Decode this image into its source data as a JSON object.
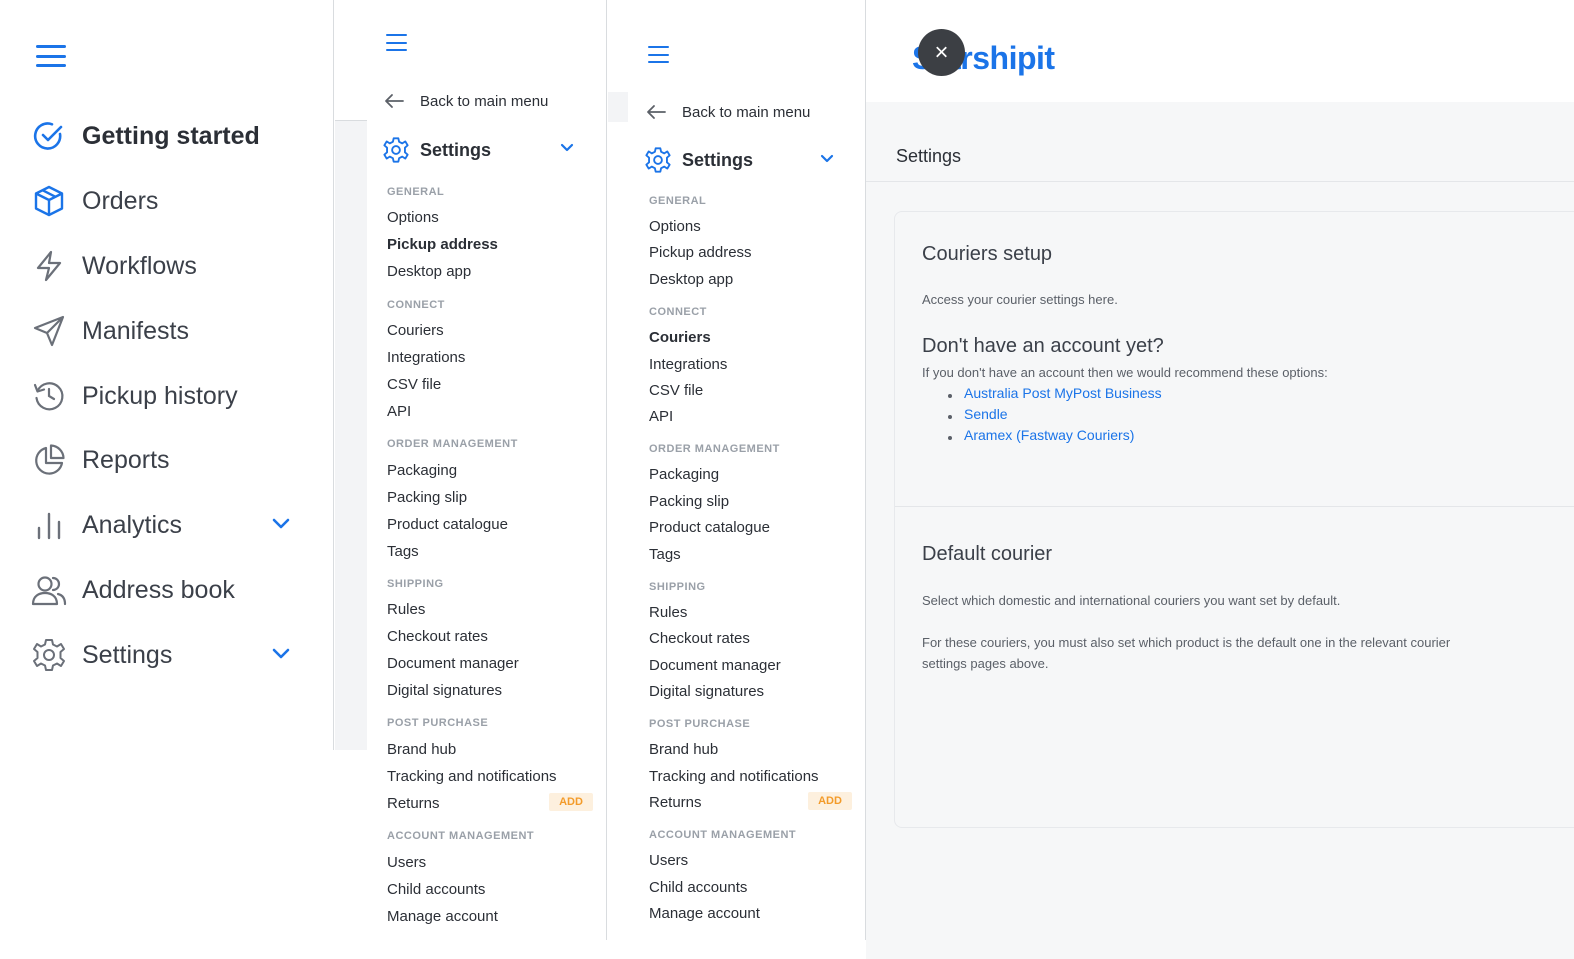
{
  "main_menu": {
    "items": [
      {
        "label": "Getting started"
      },
      {
        "label": "Orders"
      },
      {
        "label": "Workflows"
      },
      {
        "label": "Manifests"
      },
      {
        "label": "Pickup history"
      },
      {
        "label": "Reports"
      },
      {
        "label": "Analytics"
      },
      {
        "label": "Address book"
      },
      {
        "label": "Settings"
      }
    ]
  },
  "submenu": {
    "back_label": "Back to main menu",
    "settings_label": "Settings",
    "sections": {
      "general": "GENERAL",
      "connect": "CONNECT",
      "order_management": "ORDER MANAGEMENT",
      "shipping": "SHIPPING",
      "post_purchase": "POST PURCHASE",
      "account_management": "ACCOUNT MANAGEMENT"
    },
    "links": {
      "options": "Options",
      "pickup_address": "Pickup address",
      "desktop_app": "Desktop app",
      "couriers": "Couriers",
      "integrations": "Integrations",
      "csv_file": "CSV file",
      "api": "API",
      "packaging": "Packaging",
      "packing_slip": "Packing slip",
      "product_catalogue": "Product catalogue",
      "tags": "Tags",
      "rules": "Rules",
      "checkout_rates": "Checkout rates",
      "document_manager": "Document manager",
      "digital_signatures": "Digital signatures",
      "brand_hub": "Brand hub",
      "tracking": "Tracking and notifications",
      "returns": "Returns",
      "users": "Users",
      "child_accounts": "Child accounts",
      "manage_account": "Manage account"
    },
    "add_badge": "ADD"
  },
  "content": {
    "logo": "Starshipit",
    "close_symbol": "×",
    "page_title": "Settings",
    "couriers_setup": {
      "title": "Couriers setup",
      "desc": "Access your courier settings here.",
      "no_account_title": "Don't have an account yet?",
      "no_account_desc": "If you don't have an account then we would recommend these options:",
      "options": [
        "Australia Post MyPost Business",
        "Sendle",
        "Aramex (Fastway Couriers)"
      ]
    },
    "default_courier": {
      "title": "Default courier",
      "desc": "Select which domestic and international couriers you want set by default.",
      "note_line1": "For these couriers, you must also set which product is the default one in the relevant courier",
      "note_line2": "settings pages above."
    }
  },
  "colors": {
    "accent": "#1b74e8",
    "add_badge_bg": "#fdf0de",
    "add_badge_text": "#f39b2a",
    "content_bg": "#f6f7f8"
  },
  "icons": {
    "getting_started": "check-circle-icon",
    "orders": "box-icon",
    "workflows": "lightning-icon",
    "manifests": "paper-plane-icon",
    "pickup_history": "history-icon",
    "reports": "pie-chart-icon",
    "analytics": "bar-chart-icon",
    "address_book": "users-icon",
    "settings": "gear-icon"
  }
}
